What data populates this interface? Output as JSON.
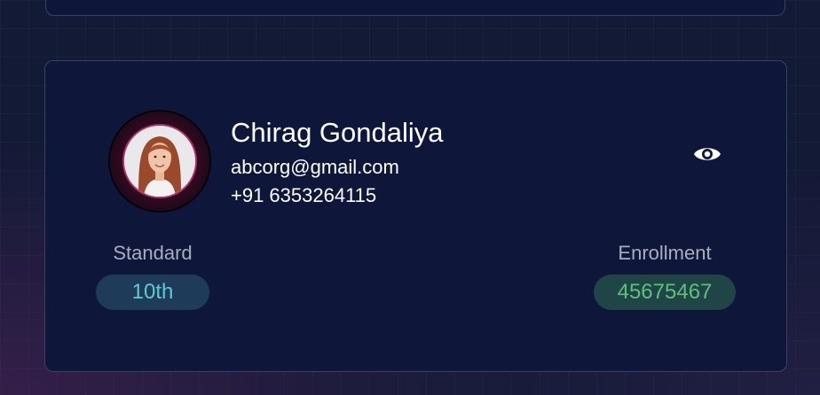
{
  "student": {
    "name": "Chirag Gondaliya",
    "email": "abcorg@gmail.com",
    "phone": "+91 6353264115",
    "avatar_icon": "student-avatar-photo",
    "view_icon": "eye-icon"
  },
  "stats": {
    "standard_label": "Standard",
    "standard_value": "10th",
    "enrollment_label": "Enrollment",
    "enrollment_value": "45675467"
  },
  "colors": {
    "card_background": "#0e173a",
    "standard_pill_text": "#5fc9d6",
    "enrollment_pill_text": "#5fc07a",
    "avatar_ring": "#b0306a"
  }
}
